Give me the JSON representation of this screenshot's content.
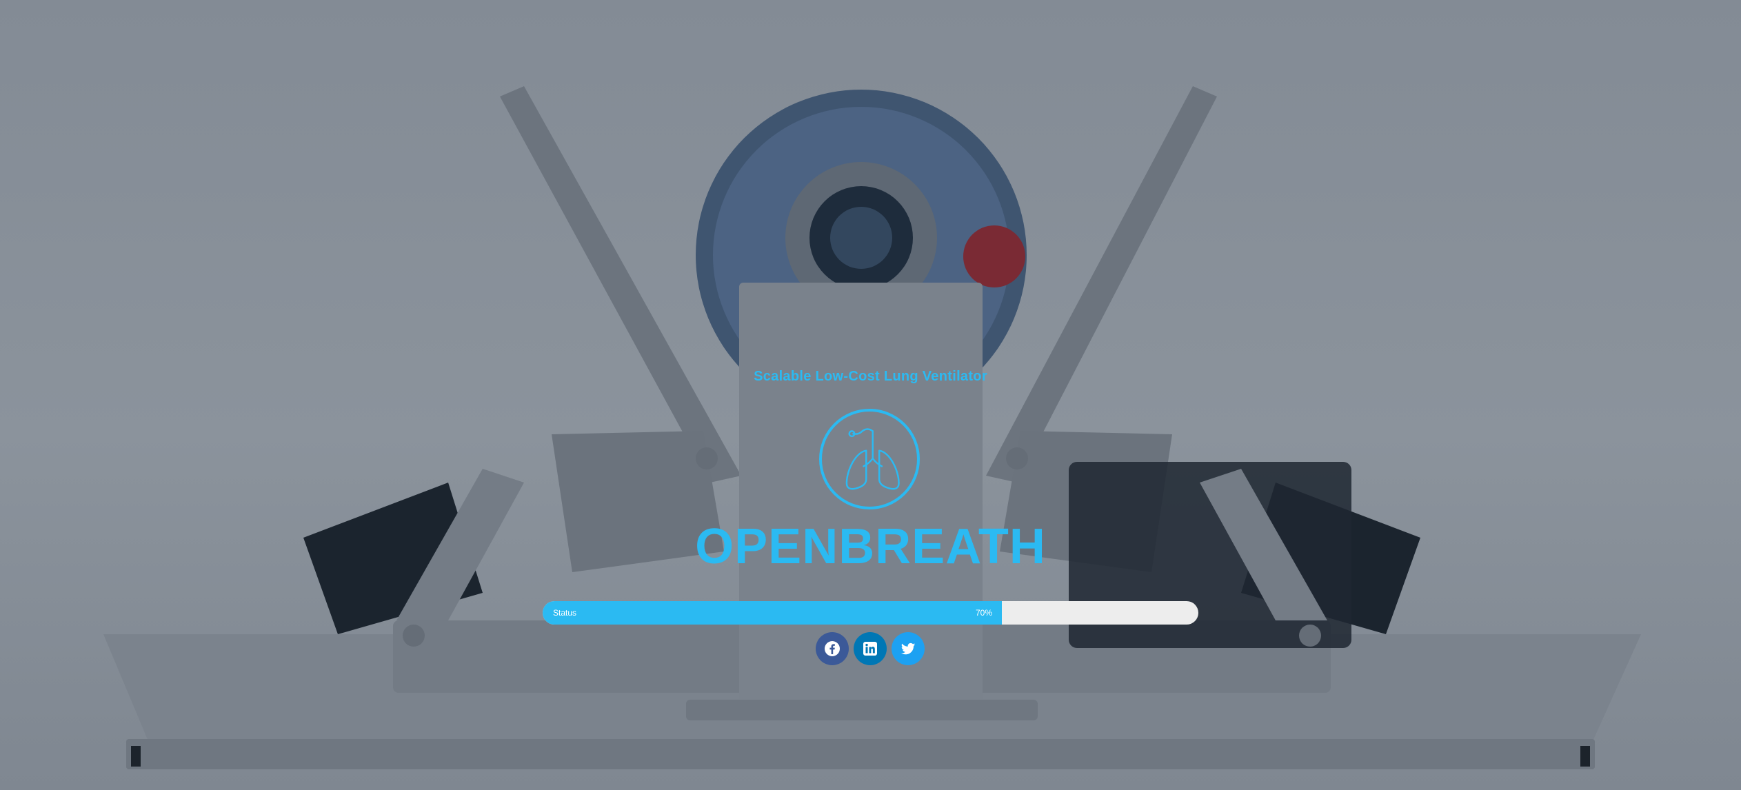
{
  "hero": {
    "tagline": "Scalable Low-Cost Lung Ventilator",
    "logo_icon": "lungs-icon",
    "brand_name": "OPENBREATH"
  },
  "status_bar": {
    "label": "Status",
    "value_text": "70%",
    "progress_fraction": 0.7
  },
  "social_links": [
    {
      "name": "facebook",
      "icon": "facebook-icon",
      "color": "#3b5998"
    },
    {
      "name": "linkedin",
      "icon": "linkedin-icon",
      "color": "#0077b5"
    },
    {
      "name": "twitter",
      "icon": "twitter-icon",
      "color": "#1da1f2"
    }
  ],
  "colors": {
    "accent": "#2bbaf2",
    "background": "#858d97",
    "progress_track": "#ededed"
  }
}
